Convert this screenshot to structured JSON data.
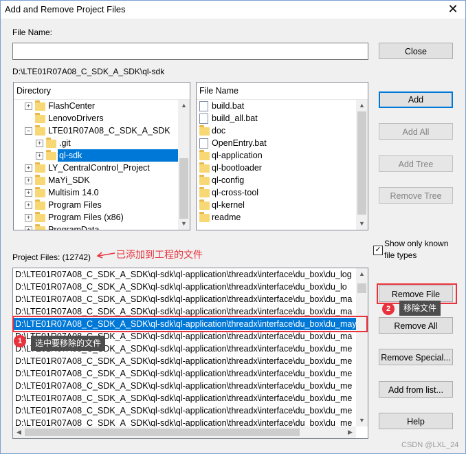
{
  "window": {
    "title": "Add and Remove Project Files",
    "close_glyph": "✕"
  },
  "file_name": {
    "label": "File Name:",
    "value": ""
  },
  "current_path": "D:\\LTE01R07A08_C_SDK_A_SDK\\ql-sdk",
  "directory": {
    "header": "Directory",
    "items": [
      {
        "label": "FlashCenter",
        "expander": "+"
      },
      {
        "label": "LenovoDrivers",
        "expander": ""
      },
      {
        "label": "LTE01R07A08_C_SDK_A_SDK",
        "expander": "−"
      },
      {
        "label": ".git",
        "expander": "+"
      },
      {
        "label": "ql-sdk",
        "expander": "+"
      },
      {
        "label": "LY_CentralControl_Project",
        "expander": "+"
      },
      {
        "label": "MaYi_SDK",
        "expander": "+"
      },
      {
        "label": "Multisim 14.0",
        "expander": "+"
      },
      {
        "label": "Program Files",
        "expander": "+"
      },
      {
        "label": "Program Files (x86)",
        "expander": "+"
      },
      {
        "label": "ProgramData",
        "expander": "+"
      }
    ]
  },
  "files": {
    "header": "File Name",
    "items": [
      {
        "label": "build.bat",
        "icon": "bat-file-icon"
      },
      {
        "label": "build_all.bat",
        "icon": "bat-file-icon"
      },
      {
        "label": "doc",
        "icon": "folder-icon"
      },
      {
        "label": "OpenEntry.bat",
        "icon": "bat-file-icon"
      },
      {
        "label": "ql-application",
        "icon": "folder-icon"
      },
      {
        "label": "ql-bootloader",
        "icon": "folder-icon"
      },
      {
        "label": "ql-config",
        "icon": "folder-icon"
      },
      {
        "label": "ql-cross-tool",
        "icon": "folder-icon"
      },
      {
        "label": "ql-kernel",
        "icon": "folder-icon"
      },
      {
        "label": "readme",
        "icon": "folder-icon"
      }
    ]
  },
  "buttons": {
    "close": "Close",
    "add": "Add",
    "add_all": "Add All",
    "add_tree": "Add Tree",
    "remove_tree": "Remove Tree",
    "remove_file": "Remove File",
    "remove_all": "Remove All",
    "remove_special": "Remove Special...",
    "add_from_list": "Add from list...",
    "help": "Help"
  },
  "show_known": {
    "label_line1": "Show only known",
    "label_line2": "file types",
    "checked": "✓"
  },
  "project_files": {
    "label": "Project Files: (12742)",
    "rows": [
      "D:\\LTE01R07A08_C_SDK_A_SDK\\ql-sdk\\ql-application\\threadx\\interface\\du_box\\du_log",
      "D:\\LTE01R07A08_C_SDK_A_SDK\\ql-sdk\\ql-application\\threadx\\interface\\du_box\\du_lo",
      "D:\\LTE01R07A08_C_SDK_A_SDK\\ql-sdk\\ql-application\\threadx\\interface\\du_box\\du_ma",
      "D:\\LTE01R07A08_C_SDK_A_SDK\\ql-sdk\\ql-application\\threadx\\interface\\du_box\\du_ma",
      "D:\\LTE01R07A08_C_SDK_A_SDK\\ql-sdk\\ql-application\\threadx\\interface\\du_box\\du_mayi.c",
      "D:\\LTE01R07A08_C_SDK_A_SDK\\ql-sdk\\ql-application\\threadx\\interface\\du_box\\du_ma",
      "D:\\LTE01R07A08_C_SDK_A_SDK\\ql-sdk\\ql-application\\threadx\\interface\\du_box\\du_me",
      "D:\\LTE01R07A08_C_SDK_A_SDK\\ql-sdk\\ql-application\\threadx\\interface\\du_box\\du_me",
      "D:\\LTE01R07A08_C_SDK_A_SDK\\ql-sdk\\ql-application\\threadx\\interface\\du_box\\du_me",
      "D:\\LTE01R07A08_C_SDK_A_SDK\\ql-sdk\\ql-application\\threadx\\interface\\du_box\\du_me",
      "D:\\LTE01R07A08_C_SDK_A_SDK\\ql-sdk\\ql-application\\threadx\\interface\\du_box\\du_me",
      "D:\\LTE01R07A08_C_SDK_A_SDK\\ql-sdk\\ql-application\\threadx\\interface\\du_box\\du_me",
      "D:\\LTE01R07A08_C_SDK_A_SDK\\ql-sdk\\ql-application\\threadx\\interface\\du_box\\du_me",
      "D:\\LTE01R07A08_C_SDK_A_SDK\\ql-sdk\\ql-application\\threadx\\interface\\du_box\\du_me"
    ],
    "selected_index": 4
  },
  "annotations": {
    "added_files_note": "已添加到工程的文件",
    "step1_number": "1",
    "step1_text": "选中要移除的文件",
    "step2_number": "2",
    "step2_text": "移除文件",
    "watermark": "CSDN @LXL_24",
    "color": "#e8323c"
  }
}
